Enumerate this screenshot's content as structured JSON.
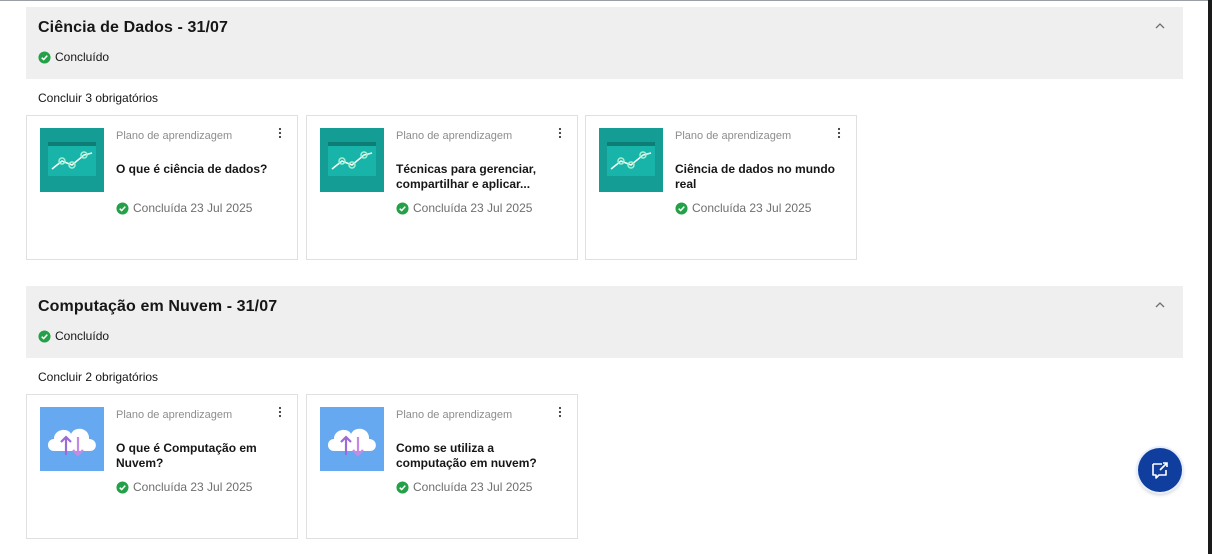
{
  "sections": [
    {
      "title": "Ciência de Dados - 31/07",
      "status": "Concluído",
      "required": "Concluir 3 obrigatórios",
      "cards": [
        {
          "type": "Plano de aprendizagem",
          "title": "O que é ciência de dados?",
          "date": "Concluída 23 Jul 2025",
          "icon": "data-chart-icon"
        },
        {
          "type": "Plano de aprendizagem",
          "title": "Técnicas para gerenciar, compartilhar e aplicar...",
          "date": "Concluída 23 Jul 2025",
          "icon": "data-chart-icon"
        },
        {
          "type": "Plano de aprendizagem",
          "title": "Ciência de dados no mundo real",
          "date": "Concluída 23 Jul 2025",
          "icon": "data-chart-icon"
        }
      ]
    },
    {
      "title": "Computação em Nuvem - 31/07",
      "status": "Concluído",
      "required": "Concluir 2 obrigatórios",
      "cards": [
        {
          "type": "Plano de aprendizagem",
          "title": "O que é Computação em Nuvem?",
          "date": "Concluída 23 Jul 2025",
          "icon": "cloud-transfer-icon"
        },
        {
          "type": "Plano de aprendizagem",
          "title": "Como se utiliza a computação em nuvem?",
          "date": "Concluída 23 Jul 2025",
          "icon": "cloud-transfer-icon"
        }
      ]
    }
  ],
  "colors": {
    "success": "#24a148",
    "teal": "#139d94",
    "sky": "#67a9f1",
    "fab": "#0f3e9e"
  },
  "fab": {
    "icon": "launch-chat-icon"
  }
}
